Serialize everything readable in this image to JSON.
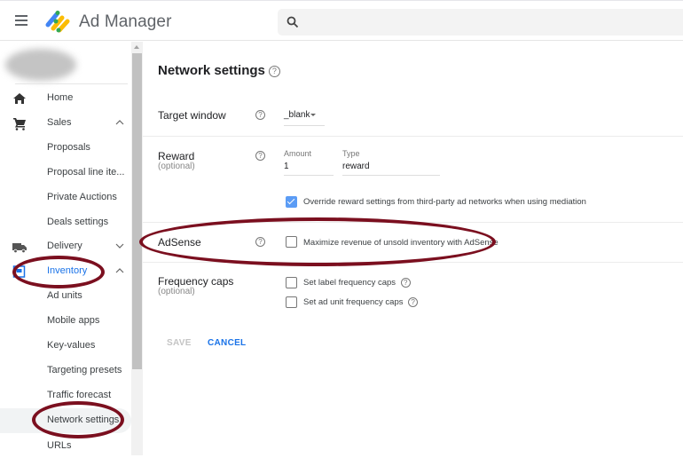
{
  "header": {
    "app_title": "Ad Manager",
    "menu_icon": "hamburger-menu-icon",
    "logo_icon": "ad-manager-logo",
    "search": {
      "placeholder": "",
      "value": "",
      "icon": "search-icon"
    }
  },
  "sidebar": {
    "network_name_redacted": true,
    "items": [
      {
        "label": "Home",
        "icon": "home-icon",
        "level": 1
      },
      {
        "label": "Sales",
        "icon": "cart-icon",
        "level": 1,
        "expanded": true
      },
      {
        "label": "Proposals",
        "level": 2
      },
      {
        "label": "Proposal line ite...",
        "level": 2
      },
      {
        "label": "Private Auctions",
        "level": 2
      },
      {
        "label": "Deals settings",
        "level": 2
      },
      {
        "label": "Delivery",
        "icon": "truck-icon",
        "level": 1,
        "expanded": false
      },
      {
        "label": "Inventory",
        "icon": "inventory-icon",
        "level": 1,
        "expanded": true,
        "active": true
      },
      {
        "label": "Ad units",
        "level": 2
      },
      {
        "label": "Mobile apps",
        "level": 2
      },
      {
        "label": "Key-values",
        "level": 2
      },
      {
        "label": "Targeting presets",
        "level": 2
      },
      {
        "label": "Traffic forecast",
        "level": 2
      },
      {
        "label": "Network settings",
        "level": 2,
        "selected": true
      },
      {
        "label": "URLs",
        "level": 2
      }
    ]
  },
  "main": {
    "title": "Network settings",
    "help_glyph": "?",
    "target_window": {
      "label": "Target window",
      "value": "_blank"
    },
    "reward": {
      "label": "Reward",
      "sublabel": "(optional)",
      "amount_label": "Amount",
      "amount_value": "1",
      "type_label": "Type",
      "type_value": "reward",
      "override_label": "Override reward settings from third-party ad networks when using mediation",
      "override_checked": true
    },
    "adsense": {
      "label": "AdSense",
      "checkbox_label": "Maximize revenue of unsold inventory with AdSense",
      "checked": false
    },
    "frequency_caps": {
      "label": "Frequency caps",
      "sublabel": "(optional)",
      "label_caps": "Set label frequency caps",
      "label_caps_checked": false,
      "ad_unit_caps": "Set ad unit frequency caps",
      "ad_unit_caps_checked": false
    },
    "buttons": {
      "save": "SAVE",
      "cancel": "CANCEL"
    }
  },
  "annotations": {
    "color": "#7b0f1f",
    "highlighted": [
      "Inventory",
      "Network settings",
      "AdSense"
    ]
  }
}
